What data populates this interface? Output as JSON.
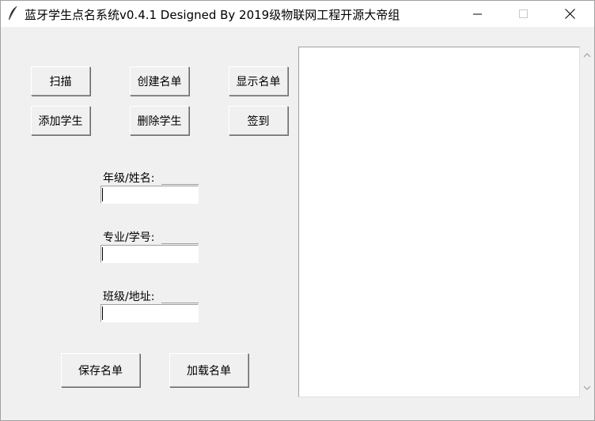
{
  "window": {
    "title": "蓝牙学生点名系统v0.4.1    Designed By 2019级物联网工程开源大帝组",
    "icon": "feather-icon"
  },
  "toolbar": {
    "scan_label": "扫描",
    "create_list_label": "创建名单",
    "show_list_label": "显示名单",
    "add_student_label": "添加学生",
    "delete_student_label": "删除学生",
    "sign_in_label": "签到"
  },
  "form": {
    "grade_name_label": "年级/姓名:",
    "grade_name_value": "",
    "major_id_label": "专业/学号:",
    "major_id_value": "",
    "class_address_label": "班级/地址:",
    "class_address_value": ""
  },
  "footer": {
    "save_list_label": "保存名单",
    "load_list_label": "加载名单"
  },
  "output": {
    "text": ""
  }
}
